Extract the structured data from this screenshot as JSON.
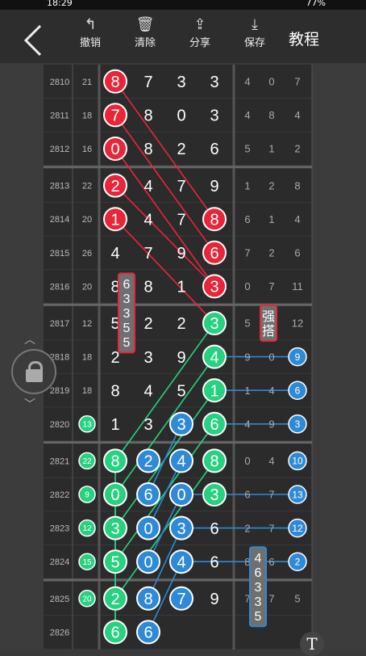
{
  "status_bar": {
    "time": "18:29",
    "battery": "77%"
  },
  "toolbar": {
    "undo": "撤销",
    "clear": "清除",
    "share": "分享",
    "save": "保存",
    "tutorial": "教程"
  },
  "rows": [
    {
      "id": "2810",
      "sum": "21",
      "main": [
        "8",
        "7",
        "3",
        "3"
      ],
      "extra": [
        "4",
        "0",
        "7"
      ]
    },
    {
      "id": "2811",
      "sum": "18",
      "main": [
        "7",
        "8",
        "0",
        "3"
      ],
      "extra": [
        "4",
        "8",
        "4"
      ]
    },
    {
      "id": "2812",
      "sum": "16",
      "main": [
        "0",
        "8",
        "2",
        "6"
      ],
      "extra": [
        "5",
        "1",
        "2"
      ]
    },
    {
      "id": "2813",
      "sum": "22",
      "main": [
        "2",
        "4",
        "7",
        "9"
      ],
      "extra": [
        "1",
        "2",
        "8"
      ]
    },
    {
      "id": "2814",
      "sum": "20",
      "main": [
        "1",
        "4",
        "7",
        "8"
      ],
      "extra": [
        "6",
        "1",
        "4"
      ]
    },
    {
      "id": "2815",
      "sum": "26",
      "main": [
        "4",
        "7",
        "9",
        "6"
      ],
      "extra": [
        "7",
        "2",
        "6"
      ]
    },
    {
      "id": "2816",
      "sum": "20",
      "main": [
        "8",
        "8",
        "1",
        "3"
      ],
      "extra": [
        "0",
        "7",
        "11"
      ]
    },
    {
      "id": "2817",
      "sum": "12",
      "main": [
        "5",
        "2",
        "2",
        "3"
      ],
      "extra": [
        "5",
        "",
        "12"
      ]
    },
    {
      "id": "2818",
      "sum": "18",
      "main": [
        "2",
        "3",
        "9",
        "4"
      ],
      "extra": [
        "9",
        "0",
        "9"
      ]
    },
    {
      "id": "2819",
      "sum": "18",
      "main": [
        "8",
        "4",
        "5",
        "1"
      ],
      "extra": [
        "1",
        "4",
        "6"
      ]
    },
    {
      "id": "2820",
      "sum": "13",
      "main": [
        "1",
        "3",
        "3",
        "6"
      ],
      "extra": [
        "4",
        "9",
        "3"
      ]
    },
    {
      "id": "2821",
      "sum": "22",
      "main": [
        "8",
        "2",
        "4",
        "8"
      ],
      "extra": [
        "0",
        "4",
        "10"
      ]
    },
    {
      "id": "2822",
      "sum": "9",
      "main": [
        "0",
        "6",
        "0",
        "3"
      ],
      "extra": [
        "6",
        "7",
        "13"
      ]
    },
    {
      "id": "2823",
      "sum": "12",
      "main": [
        "3",
        "0",
        "3",
        "6"
      ],
      "extra": [
        "2",
        "7",
        "12"
      ]
    },
    {
      "id": "2824",
      "sum": "15",
      "main": [
        "5",
        "0",
        "4",
        "6"
      ],
      "extra": [
        "8",
        "6",
        "2"
      ]
    },
    {
      "id": "2825",
      "sum": "20",
      "main": [
        "2",
        "8",
        "7",
        "9"
      ],
      "extra": [
        "7",
        "7",
        "5"
      ]
    },
    {
      "id": "2826",
      "sum": "",
      "main": [
        "6",
        "6",
        "",
        ""
      ],
      "extra": [
        "",
        "",
        ""
      ]
    }
  ],
  "annotations": {
    "box1": [
      "6",
      "3",
      "3",
      "5",
      "5"
    ],
    "box2": [
      "强",
      "搭"
    ],
    "box3": [
      "4",
      "6",
      "3",
      "3",
      "5"
    ]
  },
  "colors": {
    "red": "#e8263a",
    "green": "#27d17f",
    "blue": "#2e8ad6",
    "gray_box": "#6f6f6f"
  },
  "icons": [
    "back-arrow-icon",
    "undo-icon",
    "trash-icon",
    "share-icon",
    "download-icon",
    "lock-icon",
    "text-tool-icon"
  ]
}
